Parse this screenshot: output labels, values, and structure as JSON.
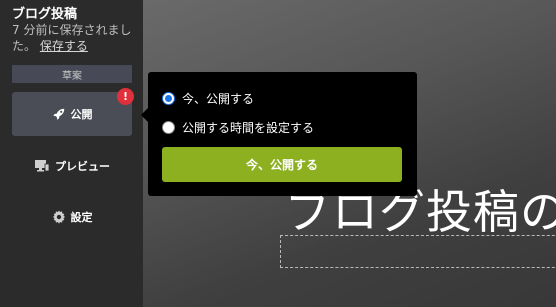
{
  "sidebar": {
    "post_title": "ブログ投稿",
    "saved_prefix": "7 分前に保存されました。",
    "saved_link": "保存する",
    "status_badge": "草案",
    "alert_mark": "!",
    "nav": {
      "publish": {
        "label": "公開",
        "icon": "rocket-icon"
      },
      "preview": {
        "label": "プレビュー",
        "icon": "monitor-icon"
      },
      "settings": {
        "label": "設定",
        "icon": "gear-icon"
      }
    }
  },
  "publish_popover": {
    "options": [
      {
        "label": "今、公開する",
        "selected": true
      },
      {
        "label": "公開する時間を設定する",
        "selected": false
      }
    ],
    "button_label": "今、公開する",
    "button_color": "#8db021"
  },
  "hero": {
    "title_partial": "ブログ投稿の"
  }
}
